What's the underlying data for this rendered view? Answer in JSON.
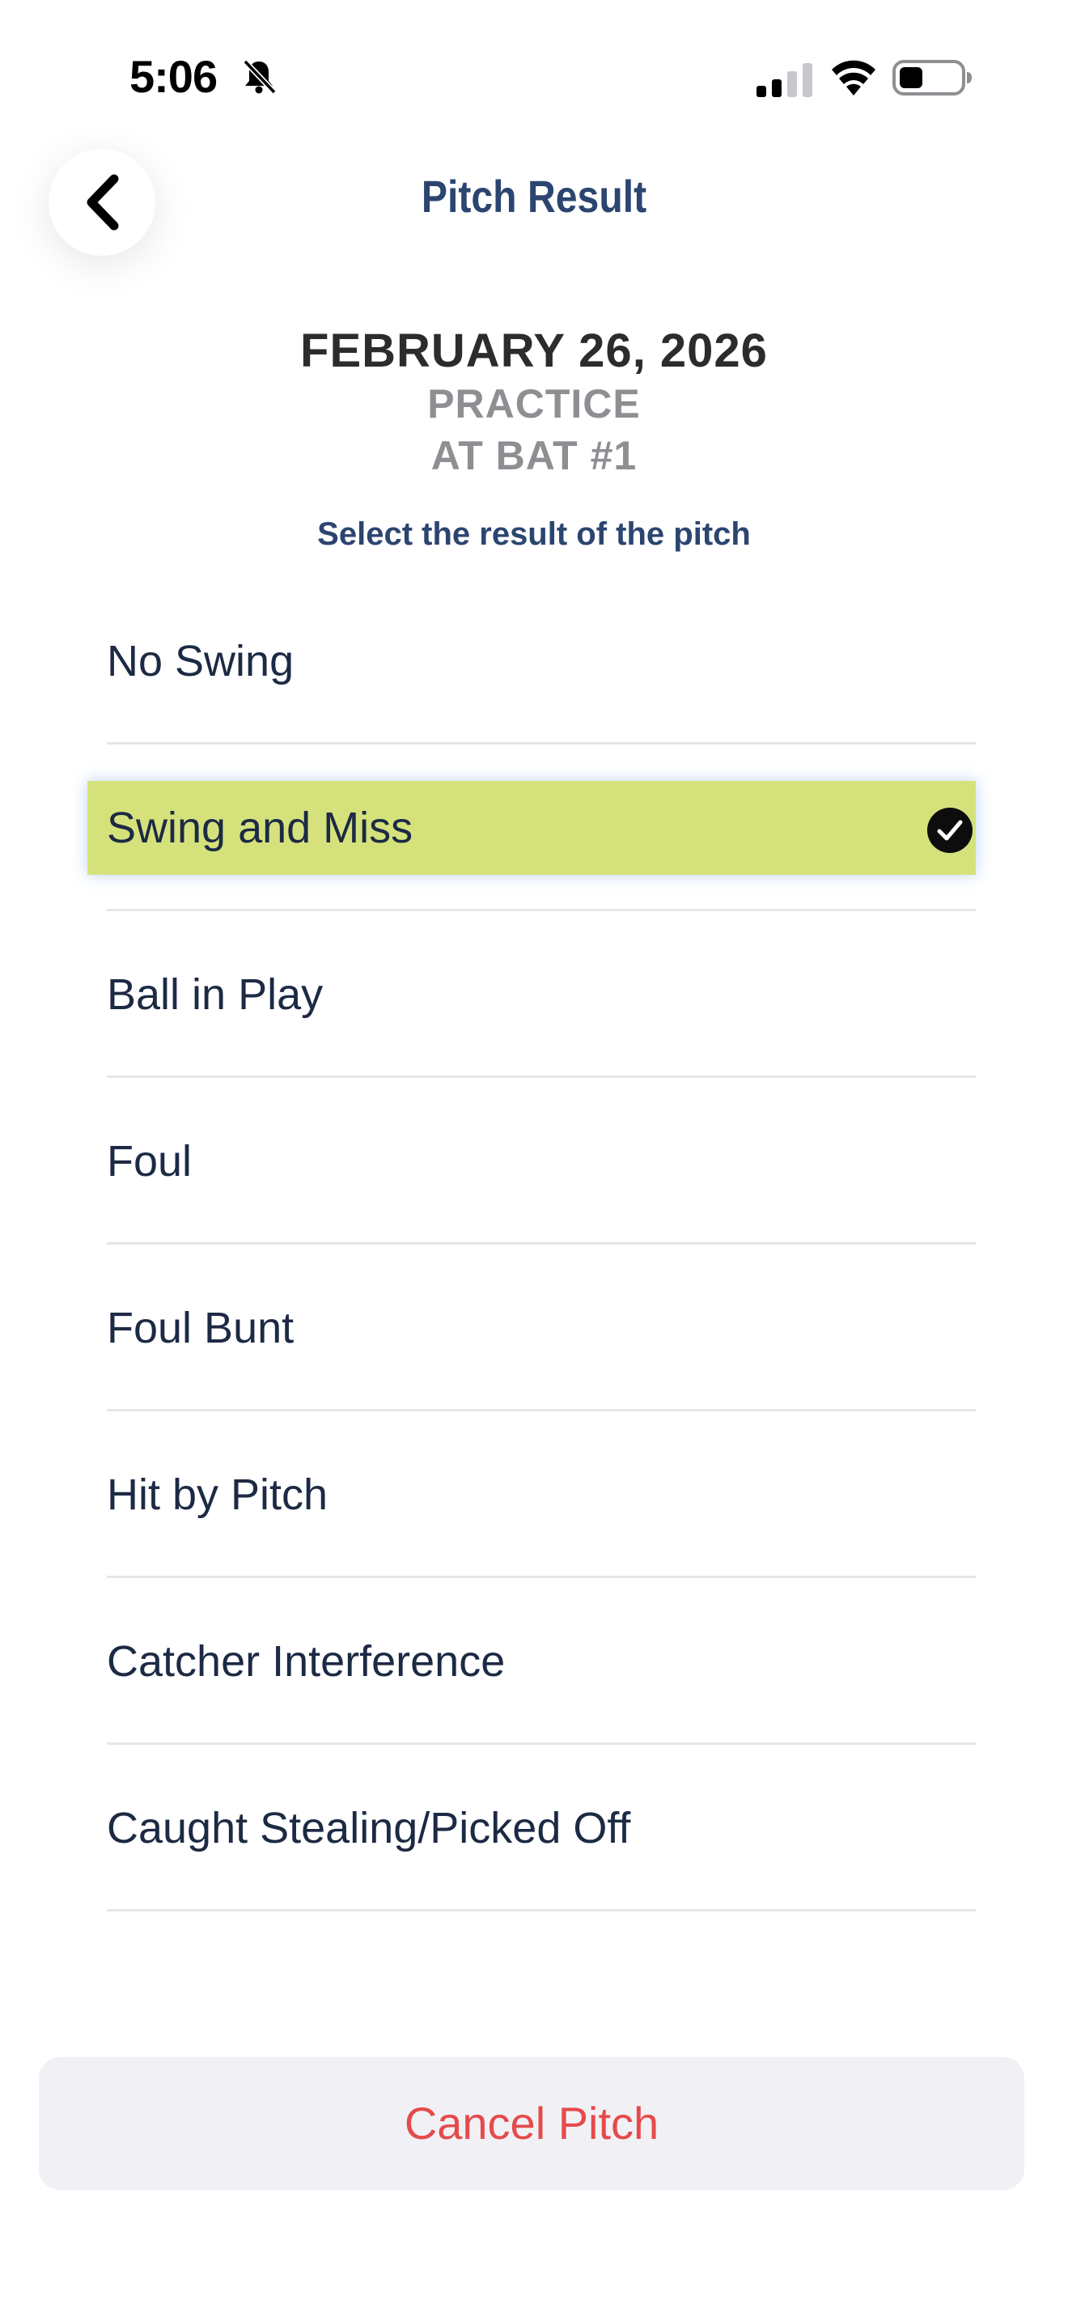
{
  "status_bar": {
    "time": "5:06",
    "icons": [
      "bell-slash-icon",
      "cellular-signal-icon",
      "wifi-icon",
      "battery-icon"
    ]
  },
  "header": {
    "back_icon": "chevron-left-icon",
    "title": "Pitch Result"
  },
  "info": {
    "date": "FEBRUARY 26, 2026",
    "type": "PRACTICE",
    "at_bat": "AT BAT #1",
    "instruction": "Select the result of the pitch"
  },
  "options": [
    {
      "label": "No Swing",
      "selected": false
    },
    {
      "label": "Swing and Miss",
      "selected": true
    },
    {
      "label": "Ball in Play",
      "selected": false
    },
    {
      "label": "Foul",
      "selected": false
    },
    {
      "label": "Foul Bunt",
      "selected": false
    },
    {
      "label": "Hit by Pitch",
      "selected": false
    },
    {
      "label": "Catcher Interference",
      "selected": false
    },
    {
      "label": "Caught Stealing/Picked Off",
      "selected": false
    }
  ],
  "cancel_label": "Cancel Pitch",
  "colors": {
    "title": "#2c4570",
    "selected_highlight": "#d5e27c",
    "cancel_text": "#e54b4b",
    "cancel_background": "#f1f1f5"
  }
}
